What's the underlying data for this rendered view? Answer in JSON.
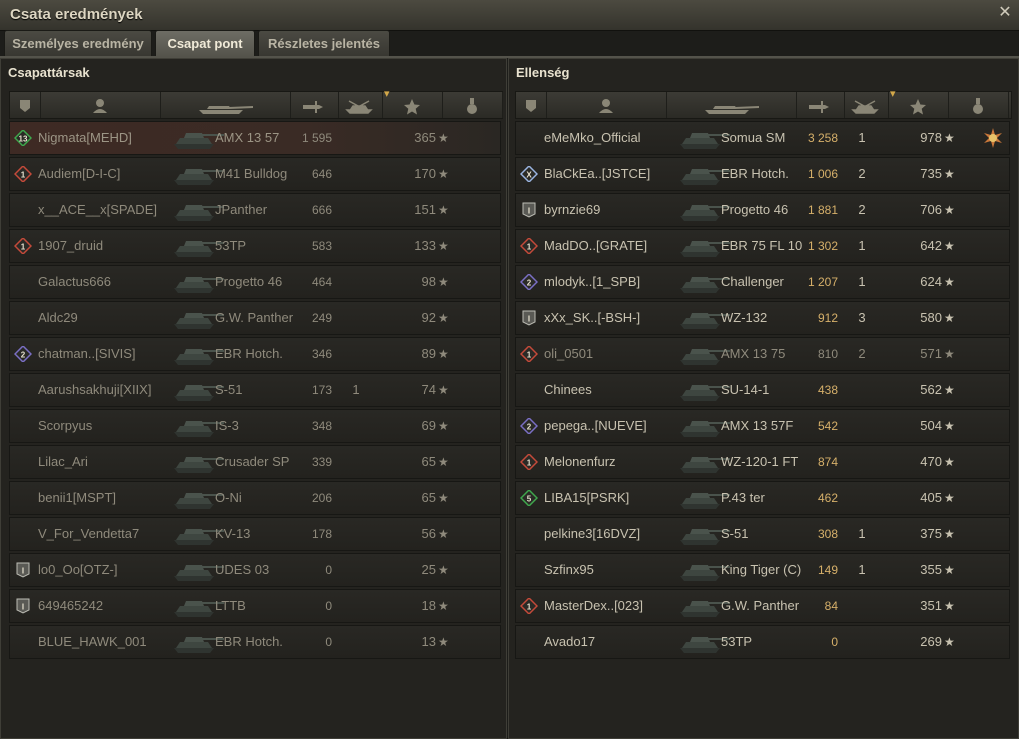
{
  "window": {
    "title": "Csata eredmények",
    "close_icon": "close-icon"
  },
  "tabs": [
    {
      "label": "Személyes eredmény",
      "active": false
    },
    {
      "label": "Csapat pont",
      "active": true
    },
    {
      "label": "Részletes jelentés",
      "active": false
    }
  ],
  "column_icons": [
    "platoon-icon",
    "player-icon",
    "tank-icon",
    "damage-icon",
    "kills-icon",
    "xp-star-icon",
    "medal-icon"
  ],
  "sort_indicator": "xp-star-icon",
  "allies": {
    "title": "Csapattársak",
    "rows": [
      {
        "badge": "13",
        "badge_color": "#3fa84d",
        "player": "Nigmata[MEHD]",
        "tank": "AMX 13 57",
        "damage": "1 595",
        "kills": "",
        "xp": "365",
        "self": true,
        "dead": true
      },
      {
        "badge": "1",
        "badge_color": "#c44a3a",
        "player": "Audiem[D-I-C]",
        "tank": "M41 Bulldog",
        "damage": "646",
        "kills": "",
        "xp": "170",
        "self": false,
        "dead": true
      },
      {
        "badge": "",
        "player": "x__ACE__x[SPADE]",
        "tank": "JPanther",
        "damage": "666",
        "kills": "",
        "xp": "151",
        "self": false,
        "dead": true
      },
      {
        "badge": "1",
        "badge_color": "#c44a3a",
        "player": "1907_druid",
        "tank": "53TP",
        "damage": "583",
        "kills": "",
        "xp": "133",
        "self": false,
        "dead": true
      },
      {
        "badge": "",
        "player": "Galactus666",
        "tank": "Progetto 46",
        "damage": "464",
        "kills": "",
        "xp": "98",
        "self": false,
        "dead": true
      },
      {
        "badge": "",
        "player": "Aldc29",
        "tank": "G.W. Panther",
        "damage": "249",
        "kills": "",
        "xp": "92",
        "self": false,
        "dead": true
      },
      {
        "badge": "2",
        "badge_color": "#7a6fc4",
        "player": "chatman..[SIVIS]",
        "tank": "EBR Hotch.",
        "damage": "346",
        "kills": "",
        "xp": "89",
        "self": false,
        "dead": true
      },
      {
        "badge": "",
        "player": "Aarushsakhuji[XIIX]",
        "tank": "S-51",
        "damage": "173",
        "kills": "1",
        "xp": "74",
        "self": false,
        "dead": true
      },
      {
        "badge": "",
        "player": "Scorpyus",
        "tank": "IS-3",
        "damage": "348",
        "kills": "",
        "xp": "69",
        "self": false,
        "dead": true
      },
      {
        "badge": "",
        "player": "Lilac_Ari",
        "tank": "Crusader SP",
        "damage": "339",
        "kills": "",
        "xp": "65",
        "self": false,
        "dead": true
      },
      {
        "badge": "",
        "player": "benii1[MSPT]",
        "tank": "O-Ni",
        "damage": "206",
        "kills": "",
        "xp": "65",
        "self": false,
        "dead": true
      },
      {
        "badge": "",
        "player": "V_For_Vendetta7",
        "tank": "KV-13",
        "damage": "178",
        "kills": "",
        "xp": "56",
        "self": false,
        "dead": true
      },
      {
        "badge": "I",
        "badge_color": "#cfcfcf",
        "player": "lo0_Oo[OTZ-]",
        "tank": "UDES 03",
        "damage": "0",
        "kills": "",
        "xp": "25",
        "self": false,
        "dead": true
      },
      {
        "badge": "I",
        "badge_color": "#cfcfcf",
        "player": "649465242",
        "tank": "LTTB",
        "damage": "0",
        "kills": "",
        "xp": "18",
        "self": false,
        "dead": true
      },
      {
        "badge": "",
        "player": "BLUE_HAWK_001",
        "tank": "EBR Hotch.",
        "damage": "0",
        "kills": "",
        "xp": "13",
        "self": false,
        "dead": true
      }
    ]
  },
  "enemies": {
    "title": "Ellenség",
    "rows": [
      {
        "badge": "",
        "player": "eMeMko_Official",
        "tank": "Somua SM",
        "damage": "3 258",
        "kills": "1",
        "xp": "978",
        "medal": true,
        "dead": false
      },
      {
        "badge": "X",
        "badge_color": "#9ab4e0",
        "player": "BlaCkEa..[JSTCE]",
        "tank": "EBR Hotch.",
        "damage": "1 006",
        "kills": "2",
        "xp": "735",
        "dead": false
      },
      {
        "badge": "I",
        "badge_color": "#cfcfcf",
        "player": "byrnzie69",
        "tank": "Progetto 46",
        "damage": "1 881",
        "kills": "2",
        "xp": "706",
        "dead": false
      },
      {
        "badge": "1",
        "badge_color": "#c44a3a",
        "player": "MadDO..[GRATE]",
        "tank": "EBR 75 FL 10",
        "damage": "1 302",
        "kills": "1",
        "xp": "642",
        "dead": false
      },
      {
        "badge": "2",
        "badge_color": "#7a6fc4",
        "player": "mlodyk..[1_SPB]",
        "tank": "Challenger",
        "damage": "1 207",
        "kills": "1",
        "xp": "624",
        "dead": false
      },
      {
        "badge": "I",
        "badge_color": "#cfcfcf",
        "player": "xXx_SK..[-BSH-]",
        "tank": "WZ-132",
        "damage": "912",
        "kills": "3",
        "xp": "580",
        "extra_badge": "1",
        "dead": false
      },
      {
        "badge": "1",
        "badge_color": "#c44a3a",
        "player": "oli_0501",
        "tank": "AMX 13 75",
        "damage": "810",
        "kills": "2",
        "xp": "571",
        "dead": true,
        "self_dim": true
      },
      {
        "badge": "",
        "player": "Chinees",
        "tank": "SU-14-1",
        "damage": "438",
        "kills": "",
        "xp": "562",
        "dead": false
      },
      {
        "badge": "2",
        "badge_color": "#7a6fc4",
        "player": "pepega..[NUEVE]",
        "tank": "AMX 13 57F",
        "damage": "542",
        "kills": "",
        "xp": "504",
        "dead": false
      },
      {
        "badge": "1",
        "badge_color": "#c44a3a",
        "player": "Melonenfurz",
        "tank": "WZ-120-1 FT",
        "damage": "874",
        "kills": "",
        "xp": "470",
        "dead": false
      },
      {
        "badge": "5",
        "badge_color": "#3fa84d",
        "player": "LIBA15[PSRK]",
        "tank": "P.43 ter",
        "damage": "462",
        "kills": "",
        "xp": "405",
        "dead": false
      },
      {
        "badge": "",
        "player": "pelkine3[16DVZ]",
        "tank": "S-51",
        "damage": "308",
        "kills": "1",
        "xp": "375",
        "dead": false
      },
      {
        "badge": "",
        "player": "Szfinx95",
        "tank": "King Tiger (C)",
        "damage": "149",
        "kills": "1",
        "xp": "355",
        "dead": false
      },
      {
        "badge": "1",
        "badge_color": "#c44a3a",
        "player": "MasterDex..[023]",
        "tank": "G.W. Panther",
        "damage": "84",
        "kills": "",
        "xp": "351",
        "dead": false
      },
      {
        "badge": "",
        "player": "Avado17",
        "tank": "53TP",
        "damage": "0",
        "kills": "",
        "xp": "269",
        "dead": false
      }
    ]
  }
}
